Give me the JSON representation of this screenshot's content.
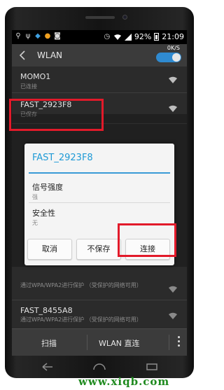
{
  "status_bar": {
    "battery": "92%",
    "time": "21:09"
  },
  "action_bar": {
    "title": "WLAN",
    "net_speed": "0K/S",
    "wlan_enabled": true
  },
  "networks": [
    {
      "name": "MOMO1",
      "status": "已连接",
      "signal": "strong"
    },
    {
      "name": "FAST_2923F8",
      "status": "已保存",
      "signal": "strong"
    },
    {
      "name": "",
      "status": "通过WPA/WPA2进行保护 （受保护的网络可用）",
      "signal": "medium"
    },
    {
      "name": "FAST_8455A8",
      "status": "通过WPA/WPA2进行保护 （受保护的网络可用）",
      "signal": "medium"
    },
    {
      "name": "",
      "status": "",
      "signal": "medium"
    }
  ],
  "dialog": {
    "title": "FAST_2923F8",
    "signal_label": "信号强度",
    "signal_value": "强",
    "security_label": "安全性",
    "security_value": "无",
    "cancel": "取消",
    "forget": "不保存",
    "connect": "连接"
  },
  "bottom_bar": {
    "scan": "扫描",
    "wlan_direct": "WLAN 直连"
  },
  "watermark": "www.xiqb.com",
  "colors": {
    "accent": "#1e9ad6",
    "highlight": "#e21a2a",
    "watermark": "#1f8a1f"
  }
}
